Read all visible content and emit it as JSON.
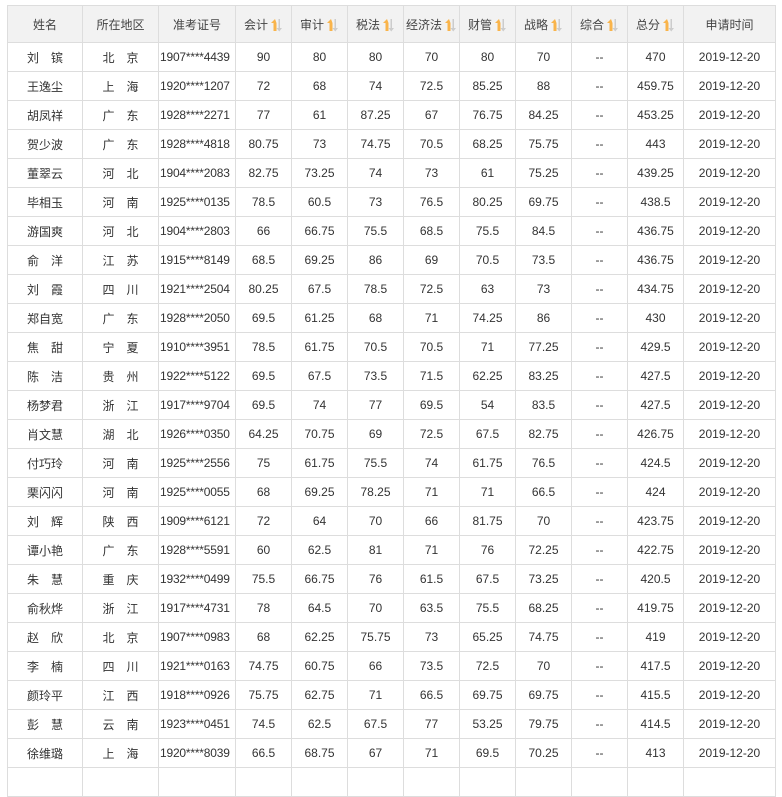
{
  "table": {
    "columns": [
      {
        "label": "姓名",
        "sortable": false
      },
      {
        "label": "所在地区",
        "sortable": false
      },
      {
        "label": "准考证号",
        "sortable": false
      },
      {
        "label": "会计",
        "sortable": true
      },
      {
        "label": "审计",
        "sortable": true
      },
      {
        "label": "税法",
        "sortable": true
      },
      {
        "label": "经济法",
        "sortable": true
      },
      {
        "label": "财管",
        "sortable": true
      },
      {
        "label": "战略",
        "sortable": true
      },
      {
        "label": "综合",
        "sortable": true
      },
      {
        "label": "总分",
        "sortable": true
      },
      {
        "label": "申请时间",
        "sortable": false
      }
    ],
    "sort_icon": "sort-up-down-icon",
    "sort_colors": {
      "up": "#f9b44b",
      "down": "#cccccc"
    },
    "rows": [
      [
        "刘　镔",
        "北　京",
        "1907****4439",
        "90",
        "80",
        "80",
        "70",
        "80",
        "70",
        "--",
        "470",
        "2019-12-20"
      ],
      [
        "王逸尘",
        "上　海",
        "1920****1207",
        "72",
        "68",
        "74",
        "72.5",
        "85.25",
        "88",
        "--",
        "459.75",
        "2019-12-20"
      ],
      [
        "胡凤祥",
        "广　东",
        "1928****2271",
        "77",
        "61",
        "87.25",
        "67",
        "76.75",
        "84.25",
        "--",
        "453.25",
        "2019-12-20"
      ],
      [
        "贺少波",
        "广　东",
        "1928****4818",
        "80.75",
        "73",
        "74.75",
        "70.5",
        "68.25",
        "75.75",
        "--",
        "443",
        "2019-12-20"
      ],
      [
        "董翠云",
        "河　北",
        "1904****2083",
        "82.75",
        "73.25",
        "74",
        "73",
        "61",
        "75.25",
        "--",
        "439.25",
        "2019-12-20"
      ],
      [
        "毕相玉",
        "河　南",
        "1925****0135",
        "78.5",
        "60.5",
        "73",
        "76.5",
        "80.25",
        "69.75",
        "--",
        "438.5",
        "2019-12-20"
      ],
      [
        "游国爽",
        "河　北",
        "1904****2803",
        "66",
        "66.75",
        "75.5",
        "68.5",
        "75.5",
        "84.5",
        "--",
        "436.75",
        "2019-12-20"
      ],
      [
        "俞　洋",
        "江　苏",
        "1915****8149",
        "68.5",
        "69.25",
        "86",
        "69",
        "70.5",
        "73.5",
        "--",
        "436.75",
        "2019-12-20"
      ],
      [
        "刘　霞",
        "四　川",
        "1921****2504",
        "80.25",
        "67.5",
        "78.5",
        "72.5",
        "63",
        "73",
        "--",
        "434.75",
        "2019-12-20"
      ],
      [
        "郑自宽",
        "广　东",
        "1928****2050",
        "69.5",
        "61.25",
        "68",
        "71",
        "74.25",
        "86",
        "--",
        "430",
        "2019-12-20"
      ],
      [
        "焦　甜",
        "宁　夏",
        "1910****3951",
        "78.5",
        "61.75",
        "70.5",
        "70.5",
        "71",
        "77.25",
        "--",
        "429.5",
        "2019-12-20"
      ],
      [
        "陈　洁",
        "贵　州",
        "1922****5122",
        "69.5",
        "67.5",
        "73.5",
        "71.5",
        "62.25",
        "83.25",
        "--",
        "427.5",
        "2019-12-20"
      ],
      [
        "杨梦君",
        "浙　江",
        "1917****9704",
        "69.5",
        "74",
        "77",
        "69.5",
        "54",
        "83.5",
        "--",
        "427.5",
        "2019-12-20"
      ],
      [
        "肖文慧",
        "湖　北",
        "1926****0350",
        "64.25",
        "70.75",
        "69",
        "72.5",
        "67.5",
        "82.75",
        "--",
        "426.75",
        "2019-12-20"
      ],
      [
        "付巧玲",
        "河　南",
        "1925****2556",
        "75",
        "61.75",
        "75.5",
        "74",
        "61.75",
        "76.5",
        "--",
        "424.5",
        "2019-12-20"
      ],
      [
        "栗闪闪",
        "河　南",
        "1925****0055",
        "68",
        "69.25",
        "78.25",
        "71",
        "71",
        "66.5",
        "--",
        "424",
        "2019-12-20"
      ],
      [
        "刘　辉",
        "陕　西",
        "1909****6121",
        "72",
        "64",
        "70",
        "66",
        "81.75",
        "70",
        "--",
        "423.75",
        "2019-12-20"
      ],
      [
        "谭小艳",
        "广　东",
        "1928****5591",
        "60",
        "62.5",
        "81",
        "71",
        "76",
        "72.25",
        "--",
        "422.75",
        "2019-12-20"
      ],
      [
        "朱　慧",
        "重　庆",
        "1932****0499",
        "75.5",
        "66.75",
        "76",
        "61.5",
        "67.5",
        "73.25",
        "--",
        "420.5",
        "2019-12-20"
      ],
      [
        "俞秋烨",
        "浙　江",
        "1917****4731",
        "78",
        "64.5",
        "70",
        "63.5",
        "75.5",
        "68.25",
        "--",
        "419.75",
        "2019-12-20"
      ],
      [
        "赵　欣",
        "北　京",
        "1907****0983",
        "68",
        "62.25",
        "75.75",
        "73",
        "65.25",
        "74.75",
        "--",
        "419",
        "2019-12-20"
      ],
      [
        "李　楠",
        "四　川",
        "1921****0163",
        "74.75",
        "60.75",
        "66",
        "73.5",
        "72.5",
        "70",
        "--",
        "417.5",
        "2019-12-20"
      ],
      [
        "颜玲平",
        "江　西",
        "1918****0926",
        "75.75",
        "62.75",
        "71",
        "66.5",
        "69.75",
        "69.75",
        "--",
        "415.5",
        "2019-12-20"
      ],
      [
        "彭　慧",
        "云　南",
        "1923****0451",
        "74.5",
        "62.5",
        "67.5",
        "77",
        "53.25",
        "79.75",
        "--",
        "414.5",
        "2019-12-20"
      ],
      [
        "徐维璐",
        "上　海",
        "1920****8039",
        "66.5",
        "68.75",
        "67",
        "71",
        "69.5",
        "70.25",
        "--",
        "413",
        "2019-12-20"
      ]
    ]
  }
}
